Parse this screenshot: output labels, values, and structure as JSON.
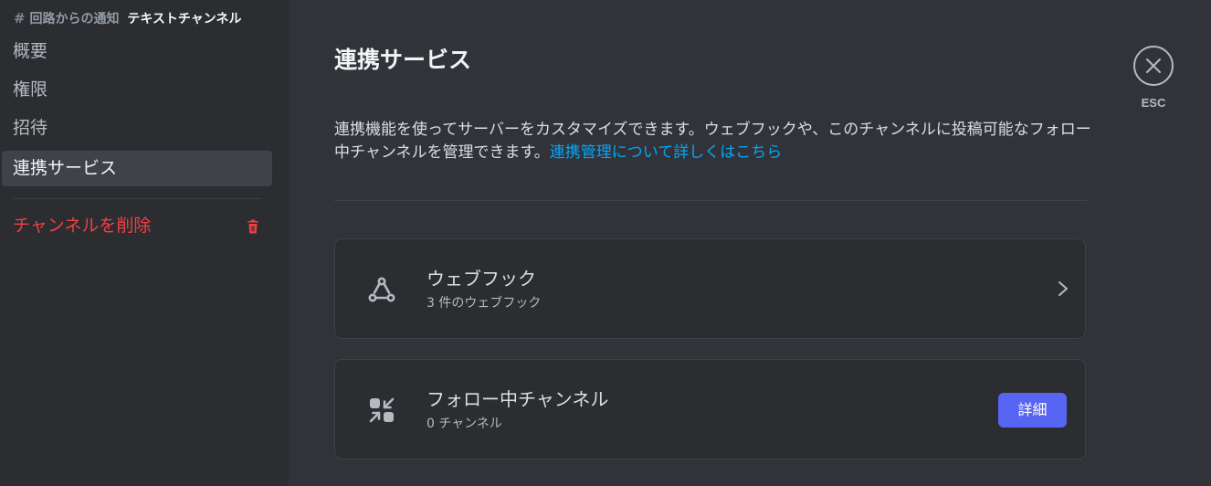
{
  "sidebar": {
    "header": {
      "hash": "#",
      "channel": "回路からの通知",
      "category": "テキストチャンネル"
    },
    "items": [
      {
        "label": "概要"
      },
      {
        "label": "権限"
      },
      {
        "label": "招待"
      },
      {
        "label": "連携サービス",
        "active": true
      }
    ],
    "delete_label": "チャンネルを削除"
  },
  "main": {
    "title": "連携サービス",
    "description": "連携機能を使ってサーバーをカスタマイズできます。ウェブフックや、このチャンネルに投稿可能なフォロー中チャンネルを管理できます。",
    "learn_more_link": "連携管理について詳しくはこちら",
    "cards": [
      {
        "title": "ウェブフック",
        "subtitle": "3 件のウェブフック",
        "icon": "webhook-icon"
      },
      {
        "title": "フォロー中チャンネル",
        "subtitle": "0 チャンネル",
        "icon": "follow-channel-icon",
        "button": "詳細"
      }
    ]
  },
  "close": {
    "label": "ESC"
  },
  "colors": {
    "accent": "#5865f2",
    "danger": "#f23f43",
    "link": "#00a8fc",
    "background": "#323339",
    "sidebar": "#2b2d31"
  }
}
